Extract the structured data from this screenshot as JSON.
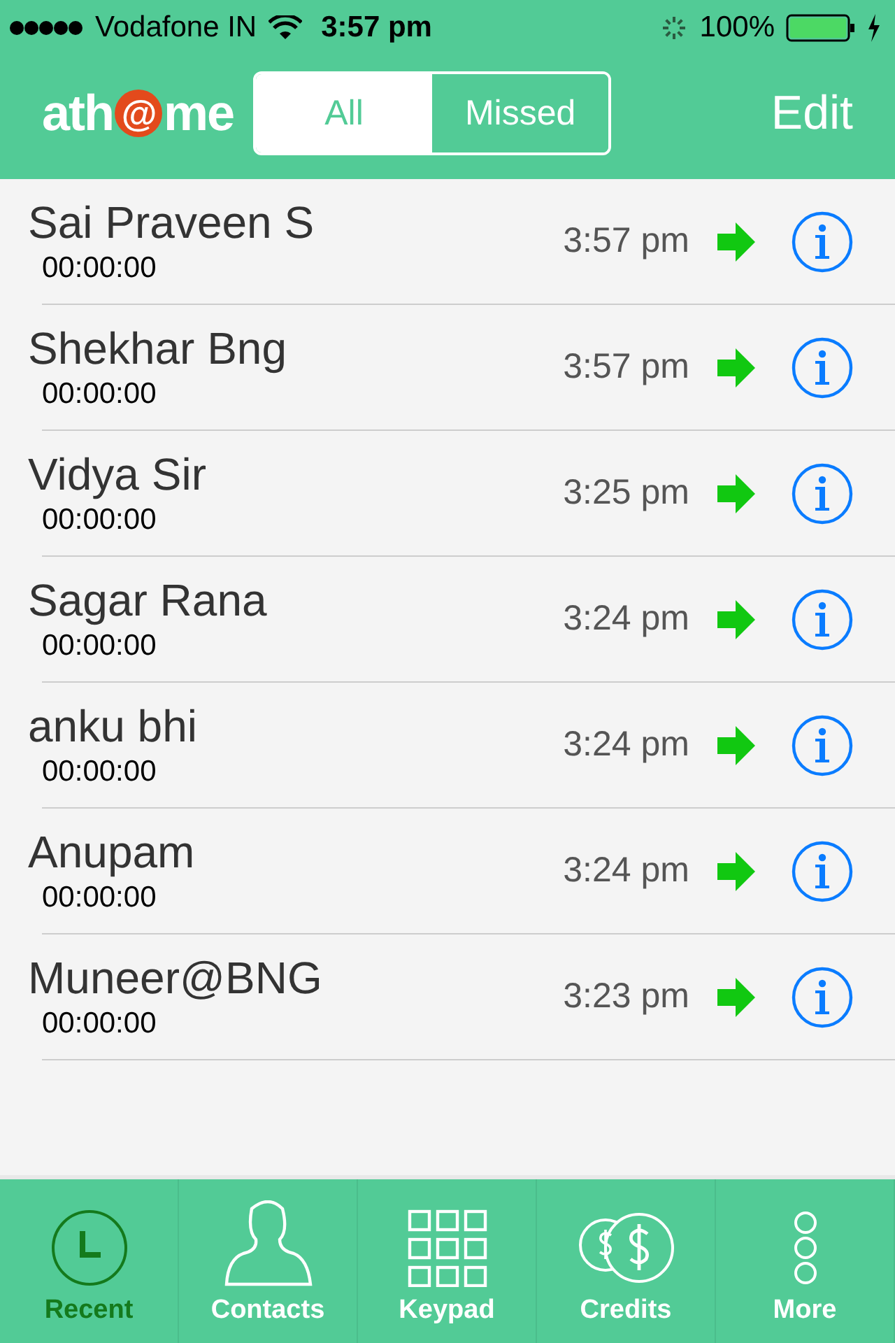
{
  "status_bar": {
    "carrier": "Vodafone IN",
    "time": "3:57 pm",
    "battery": "100%"
  },
  "nav": {
    "logo": {
      "before": "ath",
      "mark": "@",
      "after": "me"
    },
    "segments": [
      {
        "label": "All",
        "selected": true
      },
      {
        "label": "Missed",
        "selected": false
      }
    ],
    "edit": "Edit"
  },
  "calls": [
    {
      "name": "Sai Praveen S",
      "duration": "00:00:00",
      "time": "3:57 pm"
    },
    {
      "name": "Shekhar Bng",
      "duration": "00:00:00",
      "time": "3:57 pm"
    },
    {
      "name": "Vidya Sir",
      "duration": "00:00:00",
      "time": "3:25 pm"
    },
    {
      "name": "Sagar Rana",
      "duration": "00:00:00",
      "time": "3:24 pm"
    },
    {
      "name": "anku bhi",
      "duration": "00:00:00",
      "time": "3:24 pm"
    },
    {
      "name": "Anupam",
      "duration": "00:00:00",
      "time": "3:24 pm"
    },
    {
      "name": "Muneer@BNG",
      "duration": "00:00:00",
      "time": "3:23 pm"
    }
  ],
  "tab_bar": [
    {
      "label": "Recent",
      "kind": "clock",
      "selected": true
    },
    {
      "label": "Contacts",
      "kind": "person",
      "selected": false
    },
    {
      "label": "Keypad",
      "kind": "keypad",
      "selected": false
    },
    {
      "label": "Credits",
      "kind": "coins",
      "selected": false
    },
    {
      "label": "More",
      "kind": "more",
      "selected": false
    }
  ]
}
